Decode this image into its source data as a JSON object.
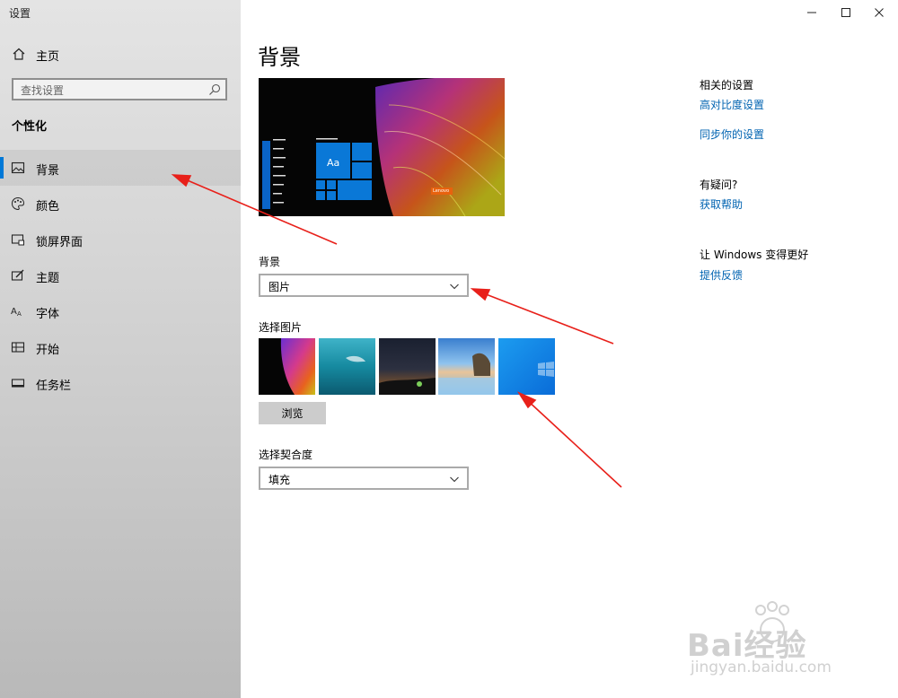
{
  "window": {
    "title": "设置"
  },
  "sidebar": {
    "home_label": "主页",
    "search_placeholder": "查找设置",
    "section_title": "个性化",
    "items": [
      {
        "label": "背景",
        "icon": "picture-icon",
        "selected": true
      },
      {
        "label": "颜色",
        "icon": "palette-icon"
      },
      {
        "label": "锁屏界面",
        "icon": "lock-screen-icon"
      },
      {
        "label": "主题",
        "icon": "theme-brush-icon"
      },
      {
        "label": "字体",
        "icon": "font-icon"
      },
      {
        "label": "开始",
        "icon": "start-menu-icon"
      },
      {
        "label": "任务栏",
        "icon": "taskbar-icon"
      }
    ]
  },
  "main": {
    "title": "背景",
    "preview": {
      "sample_text": "Aa",
      "brand_tag": "Lenovo"
    },
    "background_label": "背景",
    "background_value": "图片",
    "choose_picture_label": "选择图片",
    "browse_label": "浏览",
    "fit_label": "选择契合度",
    "fit_value": "填充"
  },
  "related": {
    "heading": "相关的设置",
    "links": [
      "高对比度设置",
      "同步你的设置"
    ],
    "question_heading": "有疑问?",
    "help_link": "获取帮助",
    "better_heading": "让 Windows 变得更好",
    "feedback_link": "提供反馈"
  },
  "watermark": {
    "logo_text": "Bai经验",
    "url": "jingyan.baidu.com"
  },
  "colors": {
    "accent": "#0078d7",
    "link": "#0063b1",
    "annotation_arrow": "#e8201a"
  }
}
